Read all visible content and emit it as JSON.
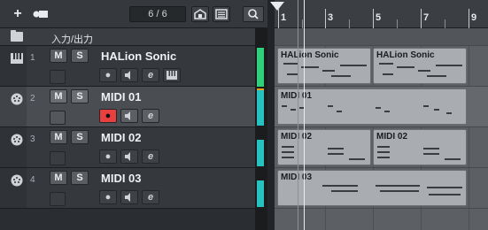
{
  "toolbar": {
    "add_label": "+",
    "track_count": "6 / 6"
  },
  "folder": {
    "label": "入力/出力"
  },
  "tracks": [
    {
      "number": "1",
      "name": "HALion Sonic",
      "mute": "M",
      "solo": "S",
      "type": "instrument-icon"
    },
    {
      "number": "2",
      "name": "MIDI 01",
      "mute": "M",
      "solo": "S",
      "type": "midi-icon",
      "record_active": true
    },
    {
      "number": "3",
      "name": "MIDI 02",
      "mute": "M",
      "solo": "S",
      "type": "midi-icon"
    },
    {
      "number": "4",
      "name": "MIDI 03",
      "mute": "M",
      "solo": "S",
      "type": "midi-icon"
    }
  ],
  "ruler": {
    "bars": [
      "1",
      "3",
      "5",
      "7",
      "9"
    ]
  },
  "parts": [
    {
      "label": "HALion Sonic"
    },
    {
      "label": "HALion Sonic"
    },
    {
      "label": "MIDI 01"
    },
    {
      "label": "MIDI 02"
    },
    {
      "label": "MIDI 02"
    },
    {
      "label": "MIDI 03"
    }
  ],
  "colors": {
    "record_active": "#e8403f",
    "meter_green": "#2fd07a",
    "meter_cyan": "#27c2c0"
  }
}
